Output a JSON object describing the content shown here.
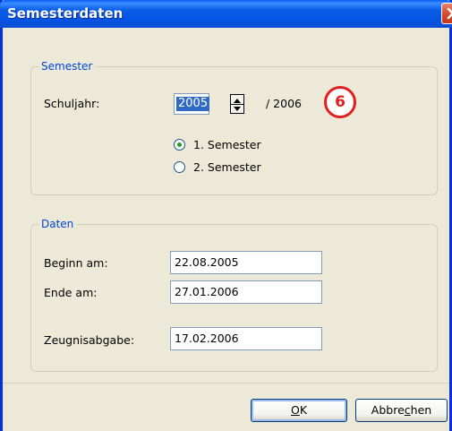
{
  "window": {
    "title": "Semesterdaten"
  },
  "semester_group": {
    "legend": "Semester",
    "schuljahr_label": "Schuljahr:",
    "year_start": "2005",
    "year_separator": "/ 2006",
    "badge": "6",
    "options": [
      {
        "label": "1. Semester",
        "selected": true
      },
      {
        "label": "2. Semester",
        "selected": false
      }
    ]
  },
  "daten_group": {
    "legend": "Daten",
    "beginn_label": "Beginn am:",
    "beginn_value": "22.08.2005",
    "ende_label": "Ende am:",
    "ende_value": "27.01.2006",
    "zeugnis_label": "Zeugnisabgabe:",
    "zeugnis_value": "17.02.2006"
  },
  "buttons": {
    "ok": "OK",
    "ok_mnemonic": "O",
    "cancel": "Abbrechen",
    "cancel_prefix": "Abbre",
    "cancel_mnemonic": "c",
    "cancel_suffix": "hen"
  },
  "colors": {
    "titlebar": "#0554e3",
    "group_legend": "#0046d5",
    "badge": "#e21f1f",
    "selection": "#316ac5"
  }
}
